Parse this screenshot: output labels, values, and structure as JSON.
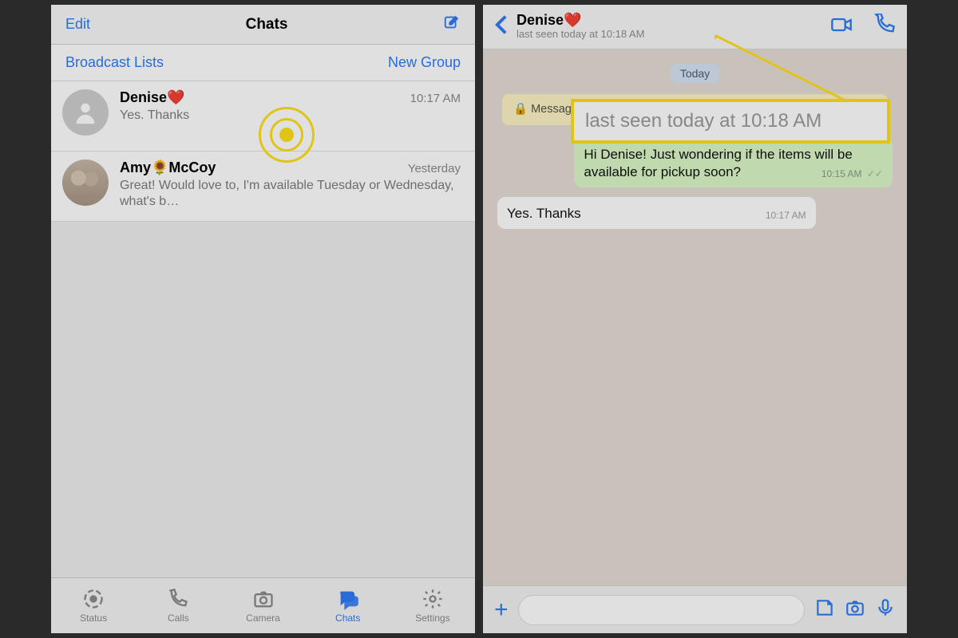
{
  "left": {
    "header": {
      "edit": "Edit",
      "title": "Chats"
    },
    "sub": {
      "broadcast": "Broadcast Lists",
      "newgroup": "New Group"
    },
    "chats": [
      {
        "name": "Denise❤️",
        "time": "10:17 AM",
        "preview": "Yes. Thanks"
      },
      {
        "name": "Amy🌻McCoy",
        "time": "Yesterday",
        "preview": "Great!  Would love to, I'm available Tuesday or Wednesday, what's b…"
      }
    ],
    "tabs": {
      "status": "Status",
      "calls": "Calls",
      "camera": "Camera",
      "chats": "Chats",
      "settings": "Settings"
    }
  },
  "right": {
    "header": {
      "name": "Denise❤️",
      "seen": "last seen today at 10:18 AM"
    },
    "day_pill": "Today",
    "system_msg": "Messages to this chat and calls are now secured",
    "messages": [
      {
        "dir": "out",
        "text": "Hi Denise! Just wondering if the items will be available for pickup soon?",
        "time": "10:15 AM"
      },
      {
        "dir": "in",
        "text": "Yes. Thanks",
        "time": "10:17 AM"
      }
    ],
    "callout_text": "last seen today at 10:18 AM"
  }
}
